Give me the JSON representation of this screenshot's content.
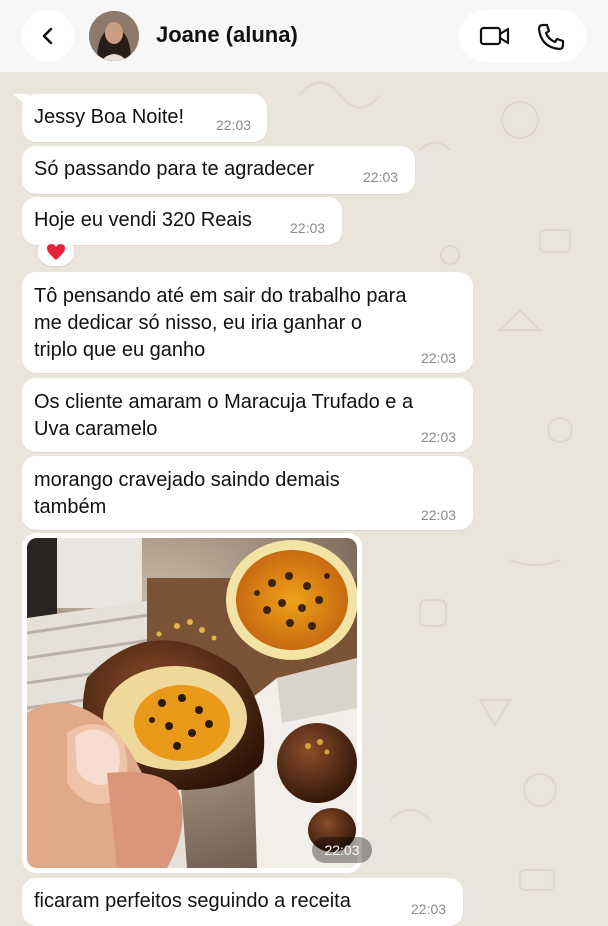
{
  "header": {
    "contact_name": "Joane (aluna)"
  },
  "messages": [
    {
      "text": "Jessy Boa Noite!",
      "time": "22:03"
    },
    {
      "text": "Só passando para te agradecer",
      "time": "22:03"
    },
    {
      "text": "Hoje eu vendi 320 Reais",
      "time": "22:03",
      "reaction": "❤️"
    },
    {
      "lines": [
        "Tô pensando até em sair do trabalho para",
        "me dedicar só nisso, eu iria ganhar o",
        "triplo que eu ganho"
      ],
      "time": "22:03"
    },
    {
      "lines": [
        "Os cliente amaram o Maracuja Trufado e a",
        "Uva caramelo"
      ],
      "time": "22:03"
    },
    {
      "lines": [
        "morango cravejado saindo demais",
        "também"
      ],
      "time": "22:03"
    },
    {
      "type": "image",
      "time": "22:03"
    },
    {
      "text": "ficaram perfeitos seguindo a receita",
      "time": "22:03"
    }
  ],
  "colors": {
    "wallpaper": "#e9e4dc",
    "bubble": "#ffffff",
    "header": "#f7f7f7",
    "timestamp": "#8a8a8a"
  },
  "icons": {
    "back": "chevron-left-icon",
    "video": "video-camera-icon",
    "phone": "phone-icon"
  }
}
